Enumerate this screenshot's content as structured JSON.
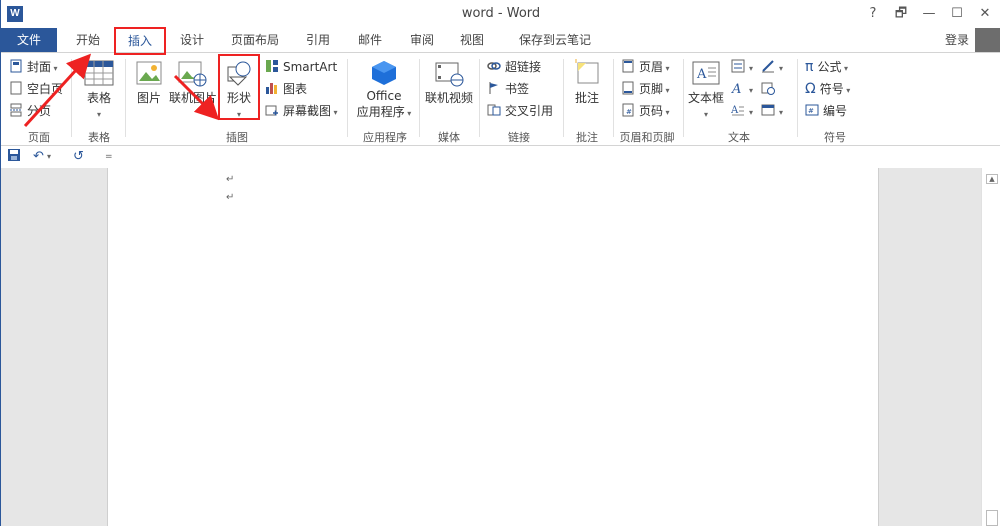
{
  "window": {
    "title": "word - Word",
    "app_icon": "W",
    "help": "?",
    "restore": "🗗",
    "minimize": "—",
    "maximize": "☐",
    "close": "✕"
  },
  "tabs": [
    {
      "label": "文件"
    },
    {
      "label": "开始"
    },
    {
      "label": "插入"
    },
    {
      "label": "设计"
    },
    {
      "label": "页面布局"
    },
    {
      "label": "引用"
    },
    {
      "label": "邮件"
    },
    {
      "label": "审阅"
    },
    {
      "label": "视图"
    },
    {
      "label": "保存到云笔记"
    }
  ],
  "login": "登录",
  "ribbon": {
    "pages": {
      "cover": "封面",
      "blank": "空白页",
      "break": "分页",
      "label": "页面"
    },
    "table": {
      "table": "表格",
      "label": "表格"
    },
    "illustrations": {
      "picture": "图片",
      "online_picture": "联机图片",
      "shapes": "形状",
      "smartart": "SmartArt",
      "chart": "图表",
      "screenshot": "屏幕截图",
      "label": "插图"
    },
    "apps": {
      "office": "Office",
      "apps": "应用程序",
      "label": "应用程序"
    },
    "media": {
      "online_video": "联机视频",
      "label": "媒体"
    },
    "links": {
      "hyperlink": "超链接",
      "bookmark": "书签",
      "cross_ref": "交叉引用",
      "label": "链接"
    },
    "comments": {
      "comment": "批注",
      "label": "批注"
    },
    "header_footer": {
      "header": "页眉",
      "footer": "页脚",
      "page_number": "页码",
      "label": "页眉和页脚"
    },
    "text": {
      "textbox": "文本框",
      "label": "文本"
    },
    "symbols": {
      "equation": "公式",
      "symbol": "符号",
      "number": "编号",
      "label": "符号",
      "pi": "π",
      "omega": "Ω"
    }
  },
  "qat": {
    "save": "save-icon",
    "undo": "↶",
    "redo": "↺",
    "customize": "="
  },
  "document": {
    "para_mark_1": "↵",
    "para_mark_2": "↵"
  },
  "colors": {
    "accent": "#2b579a",
    "annotation": "#e22222"
  }
}
